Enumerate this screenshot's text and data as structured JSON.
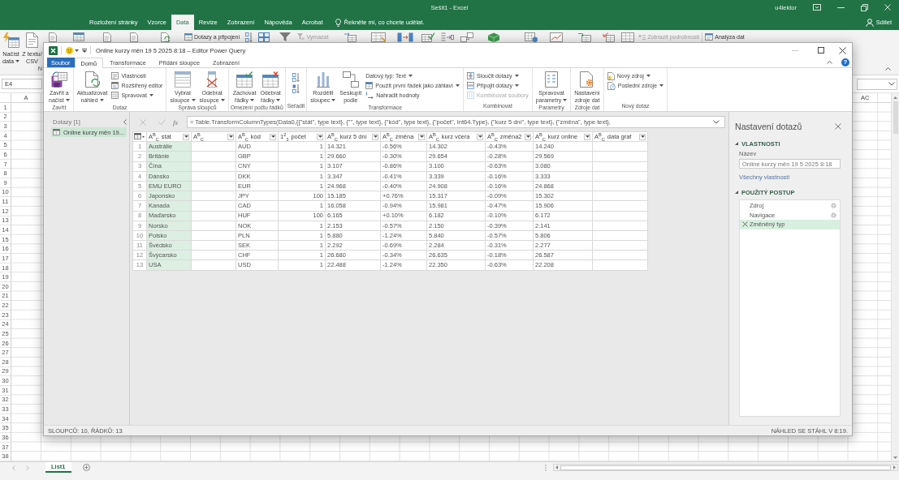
{
  "excel": {
    "title": "Sešit1 - Excel",
    "user": "u4lektor",
    "tabs": [
      {
        "label": "Rozložení stránky",
        "selected": false
      },
      {
        "label": "Vzorce",
        "selected": false
      },
      {
        "label": "Data",
        "selected": true
      },
      {
        "label": "Revize",
        "selected": false
      },
      {
        "label": "Zobrazení",
        "selected": false
      },
      {
        "label": "Nápověda",
        "selected": false
      },
      {
        "label": "Acrobat",
        "selected": false
      }
    ],
    "tell_me": "Řekněte mi, co chcete udělat.",
    "share": "Sdílet",
    "ribbon": {
      "buttons": [
        {
          "lines": [
            "Načíst",
            "data"
          ],
          "dropdown": true
        },
        {
          "lines": [
            "Z textu/",
            "CSV"
          ],
          "dropdown": false
        }
      ],
      "group_label": "N",
      "strip": [
        {
          "label": "Dotazy a připojení",
          "disabled": false
        },
        {
          "label": "Vymazat",
          "disabled": true
        },
        {
          "label": "Zobrazit podrobnosti",
          "disabled": true
        },
        {
          "label": "Analýza dat",
          "disabled": false
        }
      ]
    },
    "name_box": "E4",
    "column_headers": [
      "A",
      "AC"
    ],
    "row_numbers": [
      "1",
      "2",
      "3",
      "4",
      "5",
      "6",
      "7",
      "8",
      "9",
      "10",
      "11",
      "12",
      "13",
      "14",
      "15",
      "16",
      "17",
      "18",
      "19",
      "20",
      "21",
      "22",
      "23",
      "24",
      "25",
      "26",
      "27",
      "28",
      "29",
      "30",
      "31",
      "32",
      "33",
      "34",
      "35",
      "36",
      "37",
      "38"
    ],
    "sheets": [
      {
        "label": "List1",
        "selected": true
      }
    ]
  },
  "power_query": {
    "title": "Online kurzy měn 19 5 2025 8:18 – Editor Power Query",
    "file_tab": "Soubor",
    "tabs": [
      {
        "label": "Domů",
        "selected": true
      },
      {
        "label": "Transformace",
        "selected": false
      },
      {
        "label": "Přidání sloupce",
        "selected": false
      },
      {
        "label": "Zobrazení",
        "selected": false
      }
    ],
    "help": "?",
    "ribbon_groups": [
      {
        "label": "Zavřít",
        "items": [
          {
            "kind": "large",
            "lines": [
              "Zavřít a",
              "načíst"
            ],
            "dropdown": true
          }
        ]
      },
      {
        "label": "Dotaz",
        "items": [
          {
            "kind": "large",
            "lines": [
              "Aktualizovat",
              "náhled"
            ],
            "dropdown": true
          },
          {
            "kind": "stack",
            "entries": [
              {
                "label": "Vlastnosti",
                "dropdown": false,
                "disabled": false
              },
              {
                "label": "Rozšířený editor",
                "dropdown": false,
                "disabled": false
              },
              {
                "label": "Spravovat",
                "dropdown": true,
                "disabled": false
              }
            ]
          }
        ]
      },
      {
        "label": "Správa sloupců",
        "items": [
          {
            "kind": "large",
            "lines": [
              "Vybrat",
              "sloupce"
            ],
            "dropdown": true
          },
          {
            "kind": "large",
            "lines": [
              "Odebrat",
              "sloupce"
            ],
            "dropdown": true
          }
        ]
      },
      {
        "label": "Omezení počtu řádků",
        "items": [
          {
            "kind": "large",
            "lines": [
              "Zachovat",
              "řádky"
            ],
            "dropdown": true
          },
          {
            "kind": "large",
            "lines": [
              "Odebrat",
              "řádky"
            ],
            "dropdown": true
          }
        ]
      },
      {
        "label": "Seřadit",
        "items": [
          {
            "kind": "icons"
          }
        ]
      },
      {
        "label": "Transformace",
        "items": [
          {
            "kind": "large",
            "lines": [
              "Rozdělit",
              "sloupec"
            ],
            "dropdown": true
          },
          {
            "kind": "large",
            "lines": [
              "Seskupit",
              "podle"
            ],
            "dropdown": false
          },
          {
            "kind": "stack",
            "entries": [
              {
                "label": "Datový typ: Text",
                "dropdown": true,
                "disabled": false
              },
              {
                "label": "Použít první řádek jako záhlaví",
                "dropdown": true,
                "disabled": false
              },
              {
                "label": "Nahradit hodnoty",
                "dropdown": false,
                "disabled": false
              }
            ]
          }
        ]
      },
      {
        "label": "Kombinovat",
        "items": [
          {
            "kind": "stack",
            "entries": [
              {
                "label": "Sloučit dotazy",
                "dropdown": true,
                "disabled": false
              },
              {
                "label": "Připojit dotazy",
                "dropdown": true,
                "disabled": false
              },
              {
                "label": "Kombinovat soubory",
                "dropdown": false,
                "disabled": true
              }
            ]
          }
        ]
      },
      {
        "label": "Parametry",
        "items": [
          {
            "kind": "large",
            "lines": [
              "Spravovat",
              "parametry"
            ],
            "dropdown": true
          }
        ]
      },
      {
        "label": "Zdroje dat",
        "items": [
          {
            "kind": "large",
            "lines": [
              "Nastavení",
              "zdroje dat"
            ],
            "dropdown": false
          }
        ]
      },
      {
        "label": "Nový dotaz",
        "items": [
          {
            "kind": "stack",
            "entries": [
              {
                "label": "Nový zdroj",
                "dropdown": true,
                "disabled": false
              },
              {
                "label": "Poslední zdroje",
                "dropdown": true,
                "disabled": false
              }
            ]
          }
        ]
      }
    ],
    "queries_pane": {
      "title": "Dotazy [1]",
      "items": [
        {
          "label": "Online kurzy měn 19...",
          "selected": true
        }
      ]
    },
    "formula_bar": {
      "label": "fx",
      "formula": "= Table.TransformColumnTypes(Data0,{{\"stát\", type text}, {\"\", type text}, {\"kód\", type text}, {\"počet\", Int64.Type}, {\"kurz 5 dní\", type text}, {\"změna\", type text},"
    },
    "table": {
      "columns": [
        {
          "type": "A$^{B}$$_{C}$",
          "name": "stát",
          "kind": "text",
          "selected": true
        },
        {
          "type": "A$^{B}$$_{C}$",
          "kind": "text",
          "selected": false
        },
        {
          "type": "A$^{B}$$_{C}$",
          "name": "kód",
          "kind": "text",
          "selected": false
        },
        {
          "type": "1$^{2}$$_{3}$",
          "name": "počet",
          "kind": "number",
          "selected": false
        },
        {
          "type": "A$^{B}$$_{C}$",
          "name": "kurz 5 dní",
          "kind": "text",
          "selected": false
        },
        {
          "type": "A$^{B}$$_{C}$",
          "name": "změna",
          "kind": "text",
          "selected": false
        },
        {
          "type": "A$^{B}$$_{C}$",
          "name": "kurz včera",
          "kind": "text",
          "selected": false
        },
        {
          "type": "A$^{B}$$_{C}$",
          "name": "změna2",
          "kind": "text",
          "selected": false
        },
        {
          "type": "A$^{B}$$_{C}$",
          "name": "kurz online",
          "kind": "text",
          "selected": false
        },
        {
          "type": "A$^{B}$$_{C}$",
          "name": "data graf",
          "kind": "text",
          "selected": false
        }
      ],
      "rows": [
        {
          "number": "1",
          "cells": [
            "Austrálie",
            "",
            "AUD",
            "1",
            "14.321",
            "-0.56%",
            "14.302",
            "-0.43%",
            "14.240",
            ""
          ]
        },
        {
          "number": "2",
          "cells": [
            "Británie",
            "",
            "GBP",
            "1",
            "29.660",
            "-0.30%",
            "29.654",
            "-0.28%",
            "29.569",
            ""
          ]
        },
        {
          "number": "3",
          "cells": [
            "Čína",
            "",
            "CNY",
            "1",
            "3.107",
            "-0.86%",
            "3.100",
            "-0.63%",
            "3.080",
            ""
          ]
        },
        {
          "number": "4",
          "cells": [
            "Dánsko",
            "",
            "DKK",
            "1",
            "3.347",
            "-0.41%",
            "3.339",
            "-0.16%",
            "3.333",
            ""
          ]
        },
        {
          "number": "5",
          "cells": [
            "EMU EURO",
            "",
            "EUR",
            "1",
            "24.968",
            "-0.40%",
            "24.908",
            "-0.16%",
            "24.868",
            ""
          ]
        },
        {
          "number": "6",
          "cells": [
            "Japonsko",
            "",
            "JPY",
            "100",
            "15.185",
            "+0.76%",
            "15.317",
            "-0.09%",
            "15.302",
            ""
          ]
        },
        {
          "number": "7",
          "cells": [
            "Kanada",
            "",
            "CAD",
            "1",
            "16.058",
            "-0.94%",
            "15.981",
            "-0.47%",
            "15.906",
            ""
          ]
        },
        {
          "number": "8",
          "cells": [
            "Maďarsko",
            "",
            "HUF",
            "100",
            "6.165",
            "+0.10%",
            "6.182",
            "-0.10%",
            "6.172",
            ""
          ]
        },
        {
          "number": "9",
          "cells": [
            "Norsko",
            "",
            "NOK",
            "1",
            "2.153",
            "-0.57%",
            "2.150",
            "-0.39%",
            "2.141",
            ""
          ]
        },
        {
          "number": "10",
          "cells": [
            "Polsko",
            "",
            "PLN",
            "1",
            "5.880",
            "-1.24%",
            "5.840",
            "-0.57%",
            "5.806",
            ""
          ]
        },
        {
          "number": "11",
          "cells": [
            "Švédsko",
            "",
            "SEK",
            "1",
            "2.292",
            "-0.69%",
            "2.284",
            "-0.31%",
            "2.277",
            ""
          ]
        },
        {
          "number": "12",
          "cells": [
            "Švýcarsko",
            "",
            "CHF",
            "1",
            "26.680",
            "-0.34%",
            "26.635",
            "-0.18%",
            "26.587",
            ""
          ]
        },
        {
          "number": "13",
          "cells": [
            "USA",
            "",
            "USD",
            "1",
            "22.488",
            "-1.24%",
            "22.350",
            "-0.63%",
            "22.208",
            ""
          ]
        }
      ]
    },
    "query_settings": {
      "title": "Nastavení dotazů",
      "properties": {
        "heading": "VLASTNOSTI",
        "expanded": true,
        "name_label": "Název",
        "name_value": "Online kurzy měn 19 5 2025 8:18",
        "link": "Všechny vlastnosti"
      },
      "steps_section": {
        "heading": "POUŽITÝ POSTUP",
        "expanded": true,
        "steps": [
          {
            "label": "Zdroj",
            "selected": false,
            "settings": true
          },
          {
            "label": "Navigace",
            "selected": false,
            "settings": true
          },
          {
            "label": "Změněný typ",
            "selected": true,
            "settings": false
          }
        ]
      }
    },
    "status": {
      "left": "SLOUPCŮ: 10, ŘÁDKŮ: 13",
      "right": "NÁHLED SE STÁHL V 8:19."
    }
  }
}
